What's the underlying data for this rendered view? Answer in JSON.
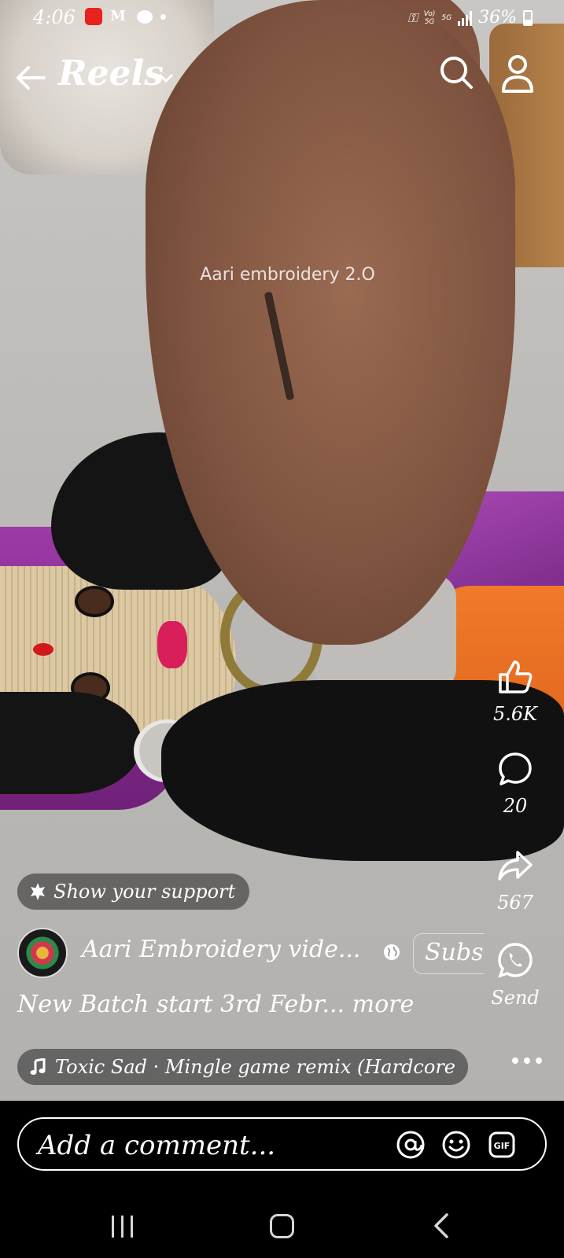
{
  "status_bar": {
    "time": "4:06",
    "battery": "36%",
    "network_label_top": "Vo)",
    "network_label_bottom": "5G",
    "network_5g": "5G"
  },
  "header": {
    "title": "Reels",
    "icons": [
      "back-arrow-icon",
      "chevron-down-icon",
      "search-icon",
      "profile-icon"
    ]
  },
  "video": {
    "watermark": "Aari embroidery 2.O"
  },
  "actions": {
    "like_count": "5.6K",
    "comment_count": "20",
    "share_count": "567",
    "send_label": "Send"
  },
  "support": {
    "label": "Show your support"
  },
  "channel": {
    "name": "Aari Embroidery vide...",
    "subscribe_label": "Subs",
    "privacy": "globe-icon"
  },
  "post": {
    "caption": "New Batch start 3rd Febr... more"
  },
  "music": {
    "track": "Toxic Sad · Mingle game remix (Hardcore"
  },
  "comment_bar": {
    "placeholder": "Add a comment...",
    "icons": [
      "at-icon",
      "emoji-icon",
      "gif-icon"
    ]
  },
  "colors": {
    "accent_white": "#ffffff",
    "pill_bg": "#464646",
    "background": "#000000"
  }
}
